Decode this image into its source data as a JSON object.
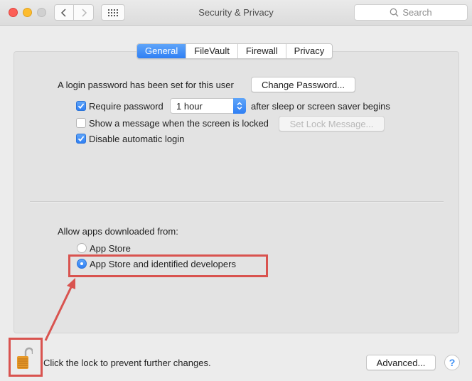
{
  "window": {
    "title": "Security & Privacy",
    "search_placeholder": "Search"
  },
  "tabs": [
    {
      "label": "General",
      "active": true
    },
    {
      "label": "FileVault",
      "active": false
    },
    {
      "label": "Firewall",
      "active": false
    },
    {
      "label": "Privacy",
      "active": false
    }
  ],
  "general": {
    "login_password_label": "A login password has been set for this user",
    "change_password_button": "Change Password...",
    "require_password": {
      "label": "Require password",
      "checked": true
    },
    "require_password_delay": "1 hour",
    "require_password_suffix": "after sleep or screen saver begins",
    "show_message": {
      "label": "Show a message when the screen is locked",
      "checked": false
    },
    "set_lock_message_button": "Set Lock Message...",
    "disable_auto_login": {
      "label": "Disable automatic login",
      "checked": true
    },
    "allow_apps_label": "Allow apps downloaded from:",
    "allow_options": [
      {
        "label": "App Store",
        "selected": false
      },
      {
        "label": "App Store and identified developers",
        "selected": true
      }
    ]
  },
  "footer": {
    "lock_text": "Click the lock to prevent further changes.",
    "advanced_button": "Advanced...",
    "help_button": "?"
  },
  "annotation": {
    "color": "#d9534f"
  }
}
